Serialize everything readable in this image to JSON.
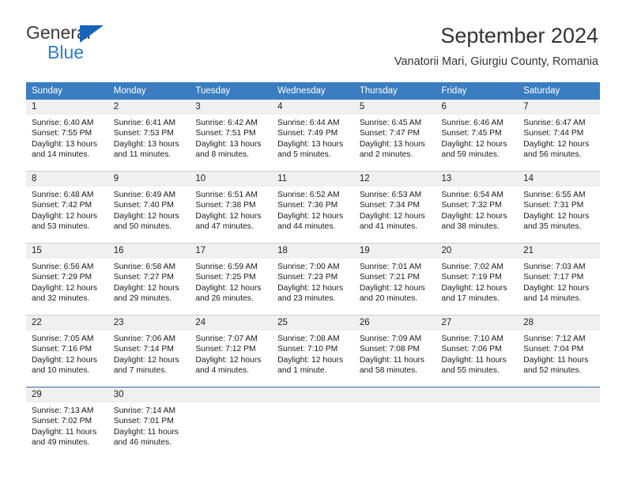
{
  "brand": {
    "line1": "General",
    "line2": "Blue",
    "triangle_icon": "blue-triangle-logo-mark",
    "color_dark": "#3b3b3b",
    "color_blue": "#2a7fd4"
  },
  "header": {
    "title": "September 2024",
    "subtitle": "Vanatorii Mari, Giurgiu County, Romania"
  },
  "theme": {
    "header_blue": "#3a7dc0",
    "daynum_bg": "#f0f0f0",
    "row_divider": "#cfcfcf",
    "last_divider": "#2e6da4"
  },
  "calendar": {
    "weekday_headers": [
      "Sunday",
      "Monday",
      "Tuesday",
      "Wednesday",
      "Thursday",
      "Friday",
      "Saturday"
    ],
    "weeks": [
      [
        {
          "day": "1",
          "sunrise": "Sunrise: 6:40 AM",
          "sunset": "Sunset: 7:55 PM",
          "daylight1": "Daylight: 13 hours",
          "daylight2": "and 14 minutes."
        },
        {
          "day": "2",
          "sunrise": "Sunrise: 6:41 AM",
          "sunset": "Sunset: 7:53 PM",
          "daylight1": "Daylight: 13 hours",
          "daylight2": "and 11 minutes."
        },
        {
          "day": "3",
          "sunrise": "Sunrise: 6:42 AM",
          "sunset": "Sunset: 7:51 PM",
          "daylight1": "Daylight: 13 hours",
          "daylight2": "and 8 minutes."
        },
        {
          "day": "4",
          "sunrise": "Sunrise: 6:44 AM",
          "sunset": "Sunset: 7:49 PM",
          "daylight1": "Daylight: 13 hours",
          "daylight2": "and 5 minutes."
        },
        {
          "day": "5",
          "sunrise": "Sunrise: 6:45 AM",
          "sunset": "Sunset: 7:47 PM",
          "daylight1": "Daylight: 13 hours",
          "daylight2": "and 2 minutes."
        },
        {
          "day": "6",
          "sunrise": "Sunrise: 6:46 AM",
          "sunset": "Sunset: 7:45 PM",
          "daylight1": "Daylight: 12 hours",
          "daylight2": "and 59 minutes."
        },
        {
          "day": "7",
          "sunrise": "Sunrise: 6:47 AM",
          "sunset": "Sunset: 7:44 PM",
          "daylight1": "Daylight: 12 hours",
          "daylight2": "and 56 minutes."
        }
      ],
      [
        {
          "day": "8",
          "sunrise": "Sunrise: 6:48 AM",
          "sunset": "Sunset: 7:42 PM",
          "daylight1": "Daylight: 12 hours",
          "daylight2": "and 53 minutes."
        },
        {
          "day": "9",
          "sunrise": "Sunrise: 6:49 AM",
          "sunset": "Sunset: 7:40 PM",
          "daylight1": "Daylight: 12 hours",
          "daylight2": "and 50 minutes."
        },
        {
          "day": "10",
          "sunrise": "Sunrise: 6:51 AM",
          "sunset": "Sunset: 7:38 PM",
          "daylight1": "Daylight: 12 hours",
          "daylight2": "and 47 minutes."
        },
        {
          "day": "11",
          "sunrise": "Sunrise: 6:52 AM",
          "sunset": "Sunset: 7:36 PM",
          "daylight1": "Daylight: 12 hours",
          "daylight2": "and 44 minutes."
        },
        {
          "day": "12",
          "sunrise": "Sunrise: 6:53 AM",
          "sunset": "Sunset: 7:34 PM",
          "daylight1": "Daylight: 12 hours",
          "daylight2": "and 41 minutes."
        },
        {
          "day": "13",
          "sunrise": "Sunrise: 6:54 AM",
          "sunset": "Sunset: 7:32 PM",
          "daylight1": "Daylight: 12 hours",
          "daylight2": "and 38 minutes."
        },
        {
          "day": "14",
          "sunrise": "Sunrise: 6:55 AM",
          "sunset": "Sunset: 7:31 PM",
          "daylight1": "Daylight: 12 hours",
          "daylight2": "and 35 minutes."
        }
      ],
      [
        {
          "day": "15",
          "sunrise": "Sunrise: 6:56 AM",
          "sunset": "Sunset: 7:29 PM",
          "daylight1": "Daylight: 12 hours",
          "daylight2": "and 32 minutes."
        },
        {
          "day": "16",
          "sunrise": "Sunrise: 6:58 AM",
          "sunset": "Sunset: 7:27 PM",
          "daylight1": "Daylight: 12 hours",
          "daylight2": "and 29 minutes."
        },
        {
          "day": "17",
          "sunrise": "Sunrise: 6:59 AM",
          "sunset": "Sunset: 7:25 PM",
          "daylight1": "Daylight: 12 hours",
          "daylight2": "and 26 minutes."
        },
        {
          "day": "18",
          "sunrise": "Sunrise: 7:00 AM",
          "sunset": "Sunset: 7:23 PM",
          "daylight1": "Daylight: 12 hours",
          "daylight2": "and 23 minutes."
        },
        {
          "day": "19",
          "sunrise": "Sunrise: 7:01 AM",
          "sunset": "Sunset: 7:21 PM",
          "daylight1": "Daylight: 12 hours",
          "daylight2": "and 20 minutes."
        },
        {
          "day": "20",
          "sunrise": "Sunrise: 7:02 AM",
          "sunset": "Sunset: 7:19 PM",
          "daylight1": "Daylight: 12 hours",
          "daylight2": "and 17 minutes."
        },
        {
          "day": "21",
          "sunrise": "Sunrise: 7:03 AM",
          "sunset": "Sunset: 7:17 PM",
          "daylight1": "Daylight: 12 hours",
          "daylight2": "and 14 minutes."
        }
      ],
      [
        {
          "day": "22",
          "sunrise": "Sunrise: 7:05 AM",
          "sunset": "Sunset: 7:16 PM",
          "daylight1": "Daylight: 12 hours",
          "daylight2": "and 10 minutes."
        },
        {
          "day": "23",
          "sunrise": "Sunrise: 7:06 AM",
          "sunset": "Sunset: 7:14 PM",
          "daylight1": "Daylight: 12 hours",
          "daylight2": "and 7 minutes."
        },
        {
          "day": "24",
          "sunrise": "Sunrise: 7:07 AM",
          "sunset": "Sunset: 7:12 PM",
          "daylight1": "Daylight: 12 hours",
          "daylight2": "and 4 minutes."
        },
        {
          "day": "25",
          "sunrise": "Sunrise: 7:08 AM",
          "sunset": "Sunset: 7:10 PM",
          "daylight1": "Daylight: 12 hours",
          "daylight2": "and 1 minute."
        },
        {
          "day": "26",
          "sunrise": "Sunrise: 7:09 AM",
          "sunset": "Sunset: 7:08 PM",
          "daylight1": "Daylight: 11 hours",
          "daylight2": "and 58 minutes."
        },
        {
          "day": "27",
          "sunrise": "Sunrise: 7:10 AM",
          "sunset": "Sunset: 7:06 PM",
          "daylight1": "Daylight: 11 hours",
          "daylight2": "and 55 minutes."
        },
        {
          "day": "28",
          "sunrise": "Sunrise: 7:12 AM",
          "sunset": "Sunset: 7:04 PM",
          "daylight1": "Daylight: 11 hours",
          "daylight2": "and 52 minutes."
        }
      ],
      [
        {
          "day": "29",
          "sunrise": "Sunrise: 7:13 AM",
          "sunset": "Sunset: 7:02 PM",
          "daylight1": "Daylight: 11 hours",
          "daylight2": "and 49 minutes."
        },
        {
          "day": "30",
          "sunrise": "Sunrise: 7:14 AM",
          "sunset": "Sunset: 7:01 PM",
          "daylight1": "Daylight: 11 hours",
          "daylight2": "and 46 minutes."
        },
        {
          "day": "",
          "sunrise": "",
          "sunset": "",
          "daylight1": "",
          "daylight2": ""
        },
        {
          "day": "",
          "sunrise": "",
          "sunset": "",
          "daylight1": "",
          "daylight2": ""
        },
        {
          "day": "",
          "sunrise": "",
          "sunset": "",
          "daylight1": "",
          "daylight2": ""
        },
        {
          "day": "",
          "sunrise": "",
          "sunset": "",
          "daylight1": "",
          "daylight2": ""
        },
        {
          "day": "",
          "sunrise": "",
          "sunset": "",
          "daylight1": "",
          "daylight2": ""
        }
      ]
    ]
  }
}
